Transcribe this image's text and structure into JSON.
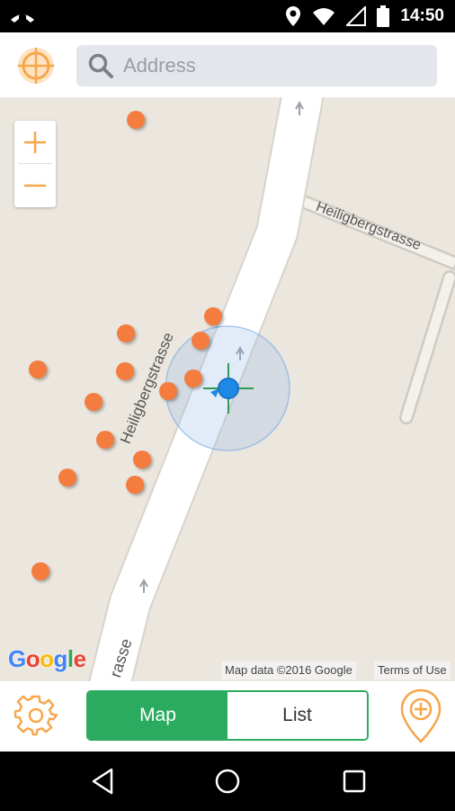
{
  "status_bar": {
    "time": "14:50",
    "icons": [
      "missed-call-icon",
      "location-icon",
      "wifi-icon",
      "signal-icon",
      "battery-icon"
    ]
  },
  "search": {
    "placeholder": "Address"
  },
  "map": {
    "street_name_main": "Heiligbergstrasse",
    "street_name_side": "Heiligbergstrasse",
    "street_name_bottom": "rasse",
    "google_logo_letters": [
      "G",
      "o",
      "o",
      "g",
      "l",
      "e"
    ],
    "map_data_text": "Map data ©2016 Google",
    "terms_text": "Terms of Use",
    "zoom_in_label": "+",
    "zoom_out_label": "−",
    "marker_color": "#f47c3f",
    "location_dot_color": "#1e88e5"
  },
  "tabs": {
    "map_label": "Map",
    "list_label": "List",
    "active": "Map"
  },
  "colors": {
    "accent_orange": "#f7a64a",
    "accent_green": "#2bab5f"
  }
}
